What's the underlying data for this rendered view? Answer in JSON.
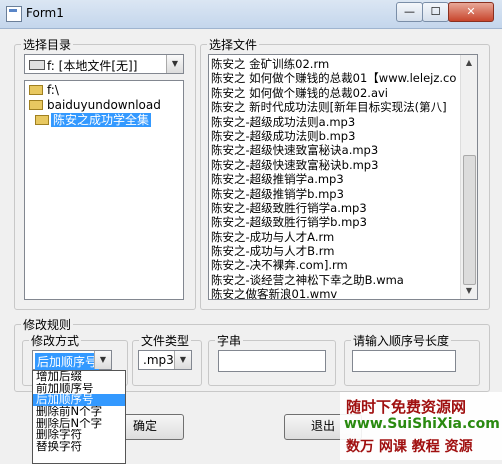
{
  "window": {
    "title": "Form1",
    "min_glyph": "—",
    "max_glyph": "☐",
    "close_glyph": "✕"
  },
  "dir_panel": {
    "legend": "选择目录",
    "drive_value": "f: [本地文件[无]]",
    "tree": [
      {
        "label": "f:\\"
      },
      {
        "label": "baiduyundownload"
      },
      {
        "label": "陈安之成功学全集",
        "selected": true
      }
    ]
  },
  "file_panel": {
    "legend": "选择文件",
    "files": [
      "陈安之 金矿训练02.rm",
      "陈安之 如何做个赚钱的总裁01【www.lelejz.co",
      "陈安之 如何做个赚钱的总裁02.avi",
      "陈安之 新时代成功法则[新年目标实现法(第八]",
      "陈安之-超级成功法则a.mp3",
      "陈安之-超级成功法则b.mp3",
      "陈安之-超级快速致富秘诀a.mp3",
      "陈安之-超级快速致富秘诀b.mp3",
      "陈安之-超级推销学a.mp3",
      "陈安之-超级推销学b.mp3",
      "陈安之-超级致胜行销学a.mp3",
      "陈安之-超级致胜行销学b.mp3",
      "陈安之-成功与人才A.rm",
      "陈安之-成功与人才B.rm",
      "陈安之-决不裸奔.com].rm",
      "陈安之-谈经营之神松下幸之助B.wma",
      "陈安之做客新浪01.wmv"
    ]
  },
  "rules": {
    "legend": "修改规则",
    "mode_legend": "修改方式",
    "mode_value": "后加顺序号",
    "mode_options": [
      "增加后缀",
      "前加顺序号",
      "后加顺序号",
      "删除前N个字",
      "删除后N个字",
      "删除字符",
      "替换字符"
    ],
    "mode_selected_index": 2,
    "filetype_legend": "文件类型",
    "filetype_value": ".mp3",
    "string_legend": "字串",
    "string_value": "",
    "seq_legend": "请输入顺序号长度",
    "seq_value": ""
  },
  "buttons": {
    "ok": "确定",
    "exit": "退出"
  },
  "watermark": {
    "line1": "随时下免费资源网",
    "line2": "www.SuiShiXia.com",
    "line3": "数万 网课 教程 资源"
  }
}
